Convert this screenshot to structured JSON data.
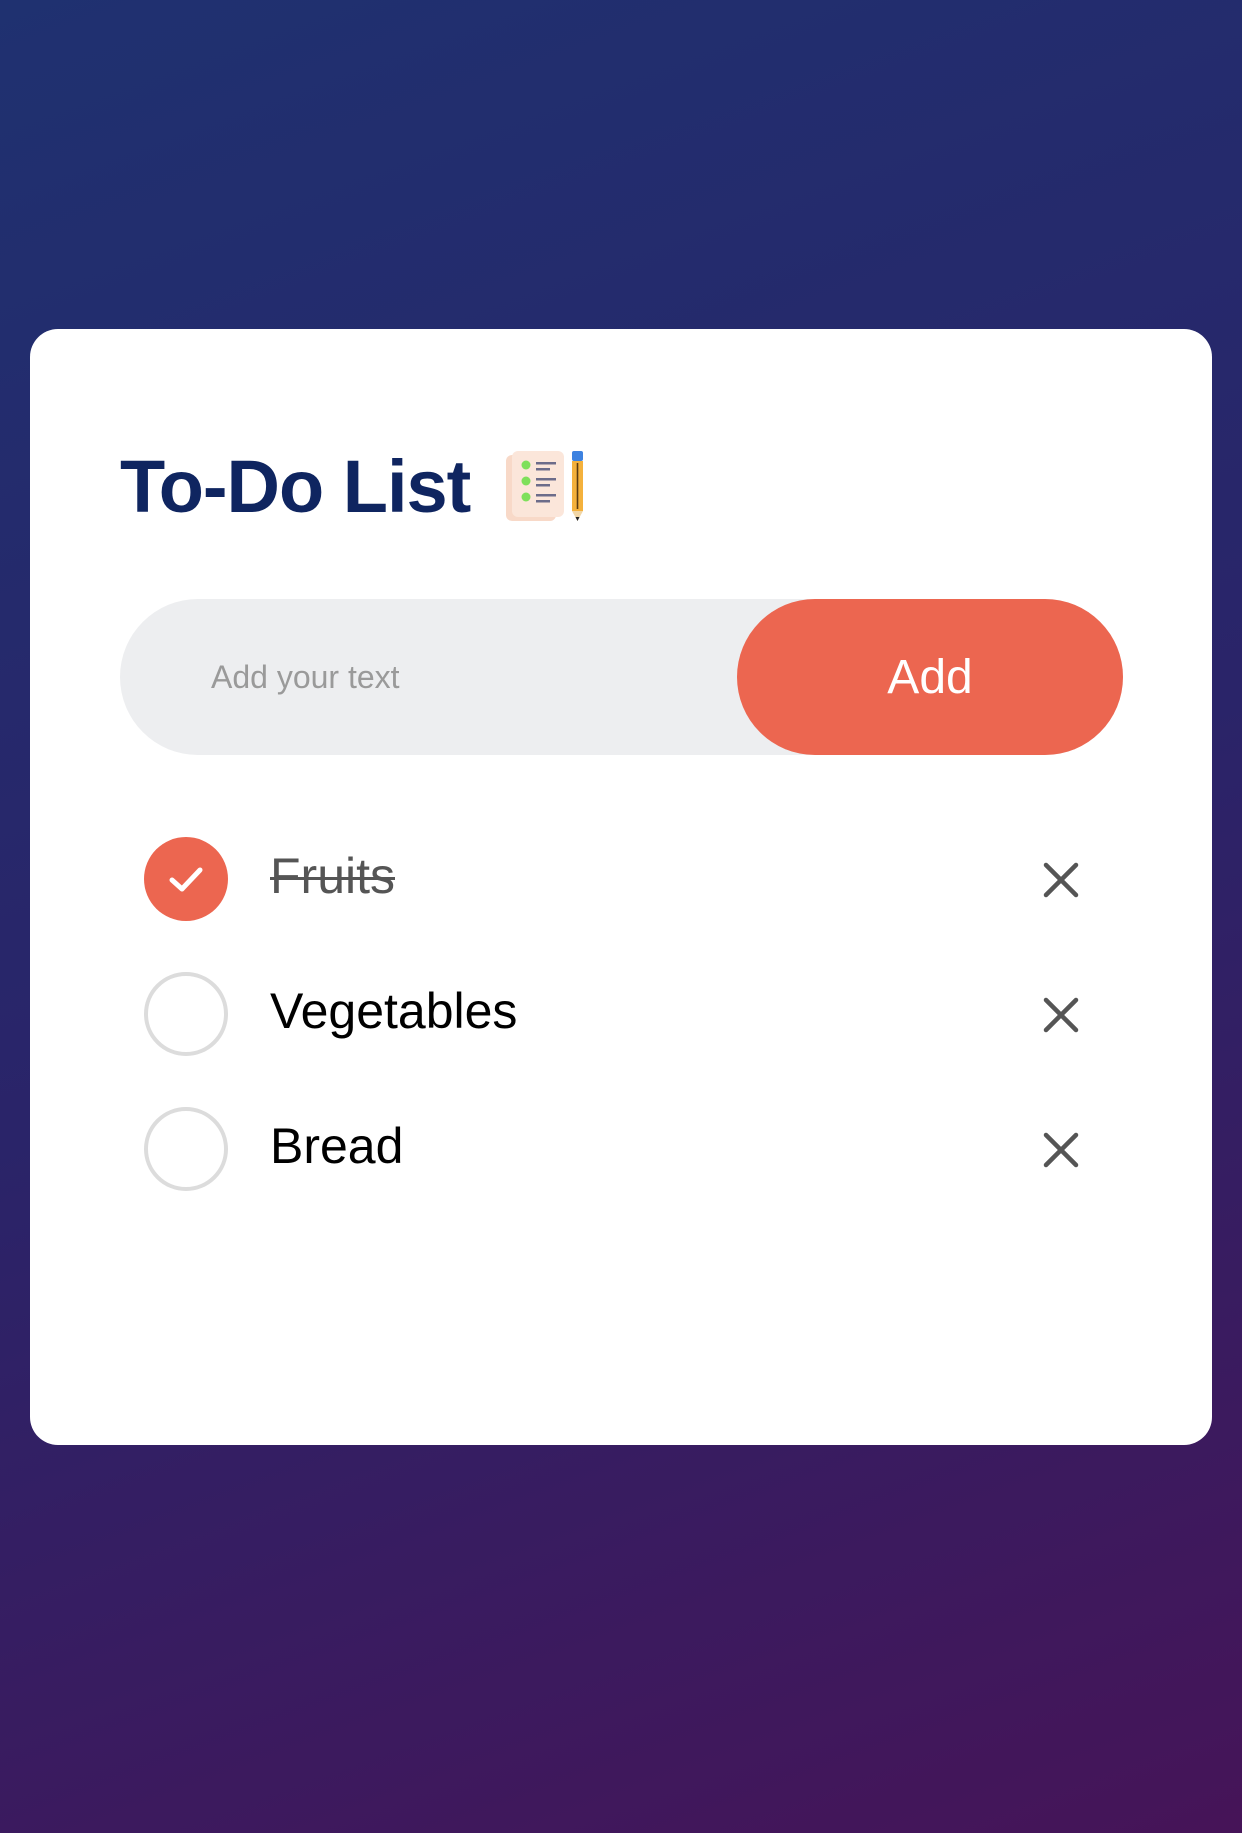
{
  "app": {
    "title": "To-Do List",
    "title_icon": "checklist-notepad-with-pencil-icon"
  },
  "input": {
    "placeholder": "Add your text",
    "value": ""
  },
  "add_button": {
    "label": "Add"
  },
  "todos": [
    {
      "text": "Fruits",
      "checked": true
    },
    {
      "text": "Vegetables",
      "checked": false
    },
    {
      "text": "Bread",
      "checked": false
    }
  ],
  "colors": {
    "accent": "#ec6650",
    "title": "#0f2560",
    "background_start": "#1f3170",
    "background_end": "#461458"
  },
  "icons": {
    "check": "checkmark-icon",
    "remove": "close-icon"
  }
}
